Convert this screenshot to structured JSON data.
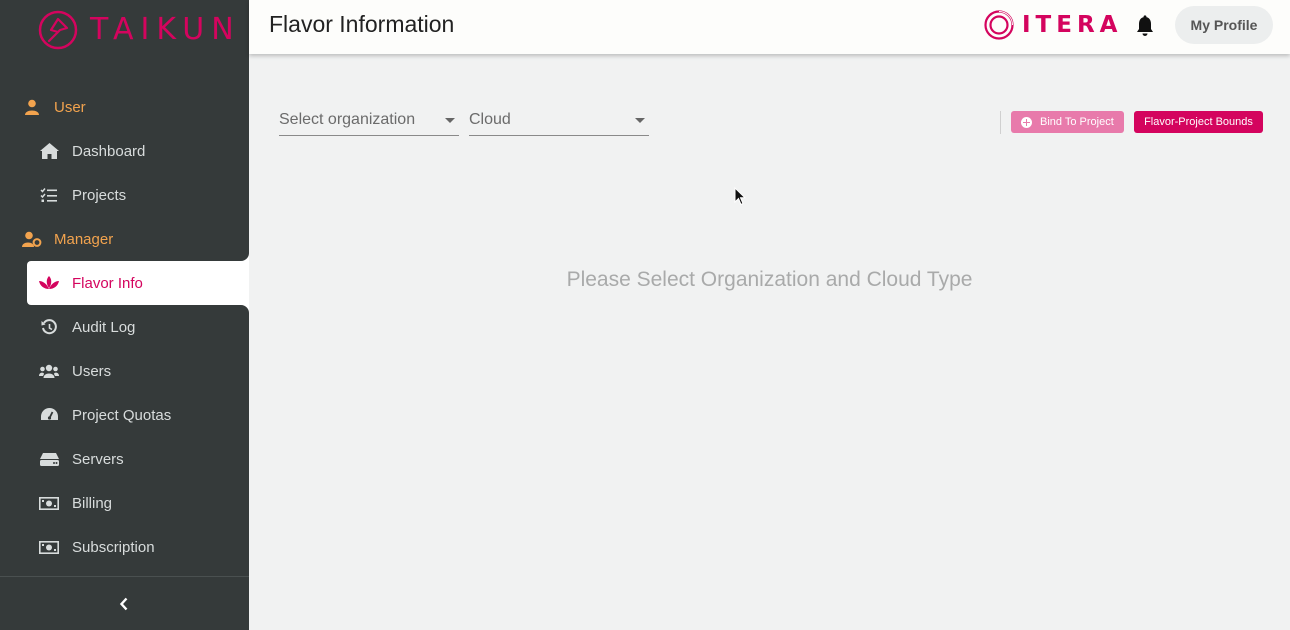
{
  "brand": {
    "logo_text": "TAIKUN",
    "partner_text": "ITERA",
    "brand_color": "#d4045e",
    "accent_color": "#f2a34e"
  },
  "header": {
    "title": "Flavor Information",
    "profile_label": "My Profile",
    "bell_icon": "bell-icon"
  },
  "sidebar": {
    "items": [
      {
        "label": "User",
        "type": "section",
        "icon": "user-icon"
      },
      {
        "label": "Dashboard",
        "type": "item",
        "icon": "home-icon"
      },
      {
        "label": "Projects",
        "type": "item",
        "icon": "list-check-icon"
      },
      {
        "label": "Manager",
        "type": "section",
        "icon": "user-cog-icon"
      },
      {
        "label": "Flavor Info",
        "type": "item",
        "icon": "lotus-icon",
        "active": true
      },
      {
        "label": "Audit Log",
        "type": "item",
        "icon": "history-icon"
      },
      {
        "label": "Users",
        "type": "item",
        "icon": "users-icon"
      },
      {
        "label": "Project Quotas",
        "type": "item",
        "icon": "gauge-icon"
      },
      {
        "label": "Servers",
        "type": "item",
        "icon": "server-icon"
      },
      {
        "label": "Billing",
        "type": "item",
        "icon": "money-icon"
      },
      {
        "label": "Subscription",
        "type": "item",
        "icon": "money-icon"
      }
    ],
    "collapse_icon": "chevron-left-icon"
  },
  "filters": {
    "organization_placeholder": "Select organization",
    "cloud_placeholder": "Cloud"
  },
  "actions": {
    "bind_label": "Bind To Project",
    "bounds_label": "Flavor-Project Bounds"
  },
  "main": {
    "empty_message": "Please Select Organization and Cloud Type"
  }
}
